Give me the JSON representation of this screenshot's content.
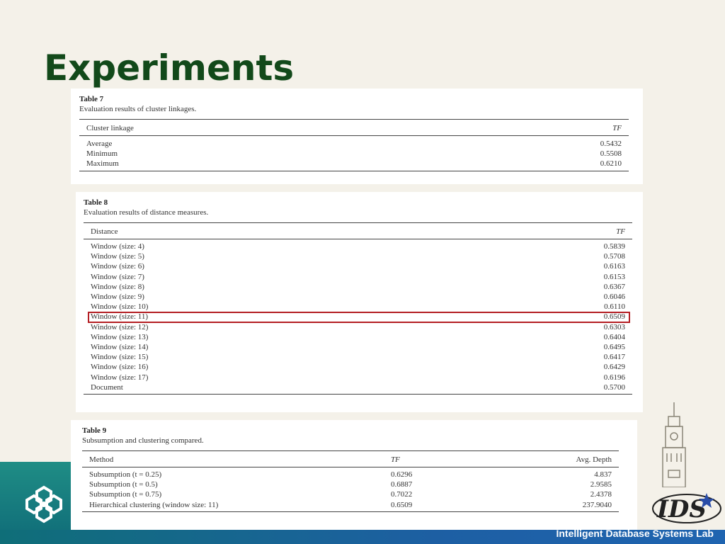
{
  "slide": {
    "title": "Experiments",
    "footer_lab": "Intelligent Database Systems Lab",
    "colors": {
      "title": "#12491a",
      "highlight": "#b41e23",
      "band": "#0f6e78"
    }
  },
  "table7": {
    "title": "Table 7",
    "caption": "Evaluation results of cluster linkages.",
    "headers": [
      "Cluster linkage",
      "TF"
    ],
    "rows": [
      [
        "Average",
        "0.5432"
      ],
      [
        "Minimum",
        "0.5508"
      ],
      [
        "Maximum",
        "0.6210"
      ]
    ]
  },
  "table8": {
    "title": "Table 8",
    "caption": "Evaluation results of distance measures.",
    "headers": [
      "Distance",
      "TF"
    ],
    "rows": [
      [
        "Window (size: 4)",
        "0.5839"
      ],
      [
        "Window (size: 5)",
        "0.5708"
      ],
      [
        "Window (size: 6)",
        "0.6163"
      ],
      [
        "Window (size: 7)",
        "0.6153"
      ],
      [
        "Window (size: 8)",
        "0.6367"
      ],
      [
        "Window (size: 9)",
        "0.6046"
      ],
      [
        "Window (size: 10)",
        "0.6110"
      ],
      [
        "Window (size: 11)",
        "0.6509"
      ],
      [
        "Window (size: 12)",
        "0.6303"
      ],
      [
        "Window (size: 13)",
        "0.6404"
      ],
      [
        "Window (size: 14)",
        "0.6495"
      ],
      [
        "Window (size: 15)",
        "0.6417"
      ],
      [
        "Window (size: 16)",
        "0.6429"
      ],
      [
        "Window (size: 17)",
        "0.6196"
      ],
      [
        "Document",
        "0.5700"
      ]
    ]
  },
  "table9": {
    "title": "Table 9",
    "caption": "Subsumption and clustering compared.",
    "headers": [
      "Method",
      "TF",
      "Avg. Depth"
    ],
    "rows": [
      [
        "Subsumption (t = 0.25)",
        "0.6296",
        "4.837"
      ],
      [
        "Subsumption (t = 0.5)",
        "0.6887",
        "2.9585"
      ],
      [
        "Subsumption (t = 0.75)",
        "0.7022",
        "2.4378"
      ],
      [
        "Hierarchical clustering (window size: 11)",
        "0.6509",
        "237.9040"
      ]
    ]
  }
}
